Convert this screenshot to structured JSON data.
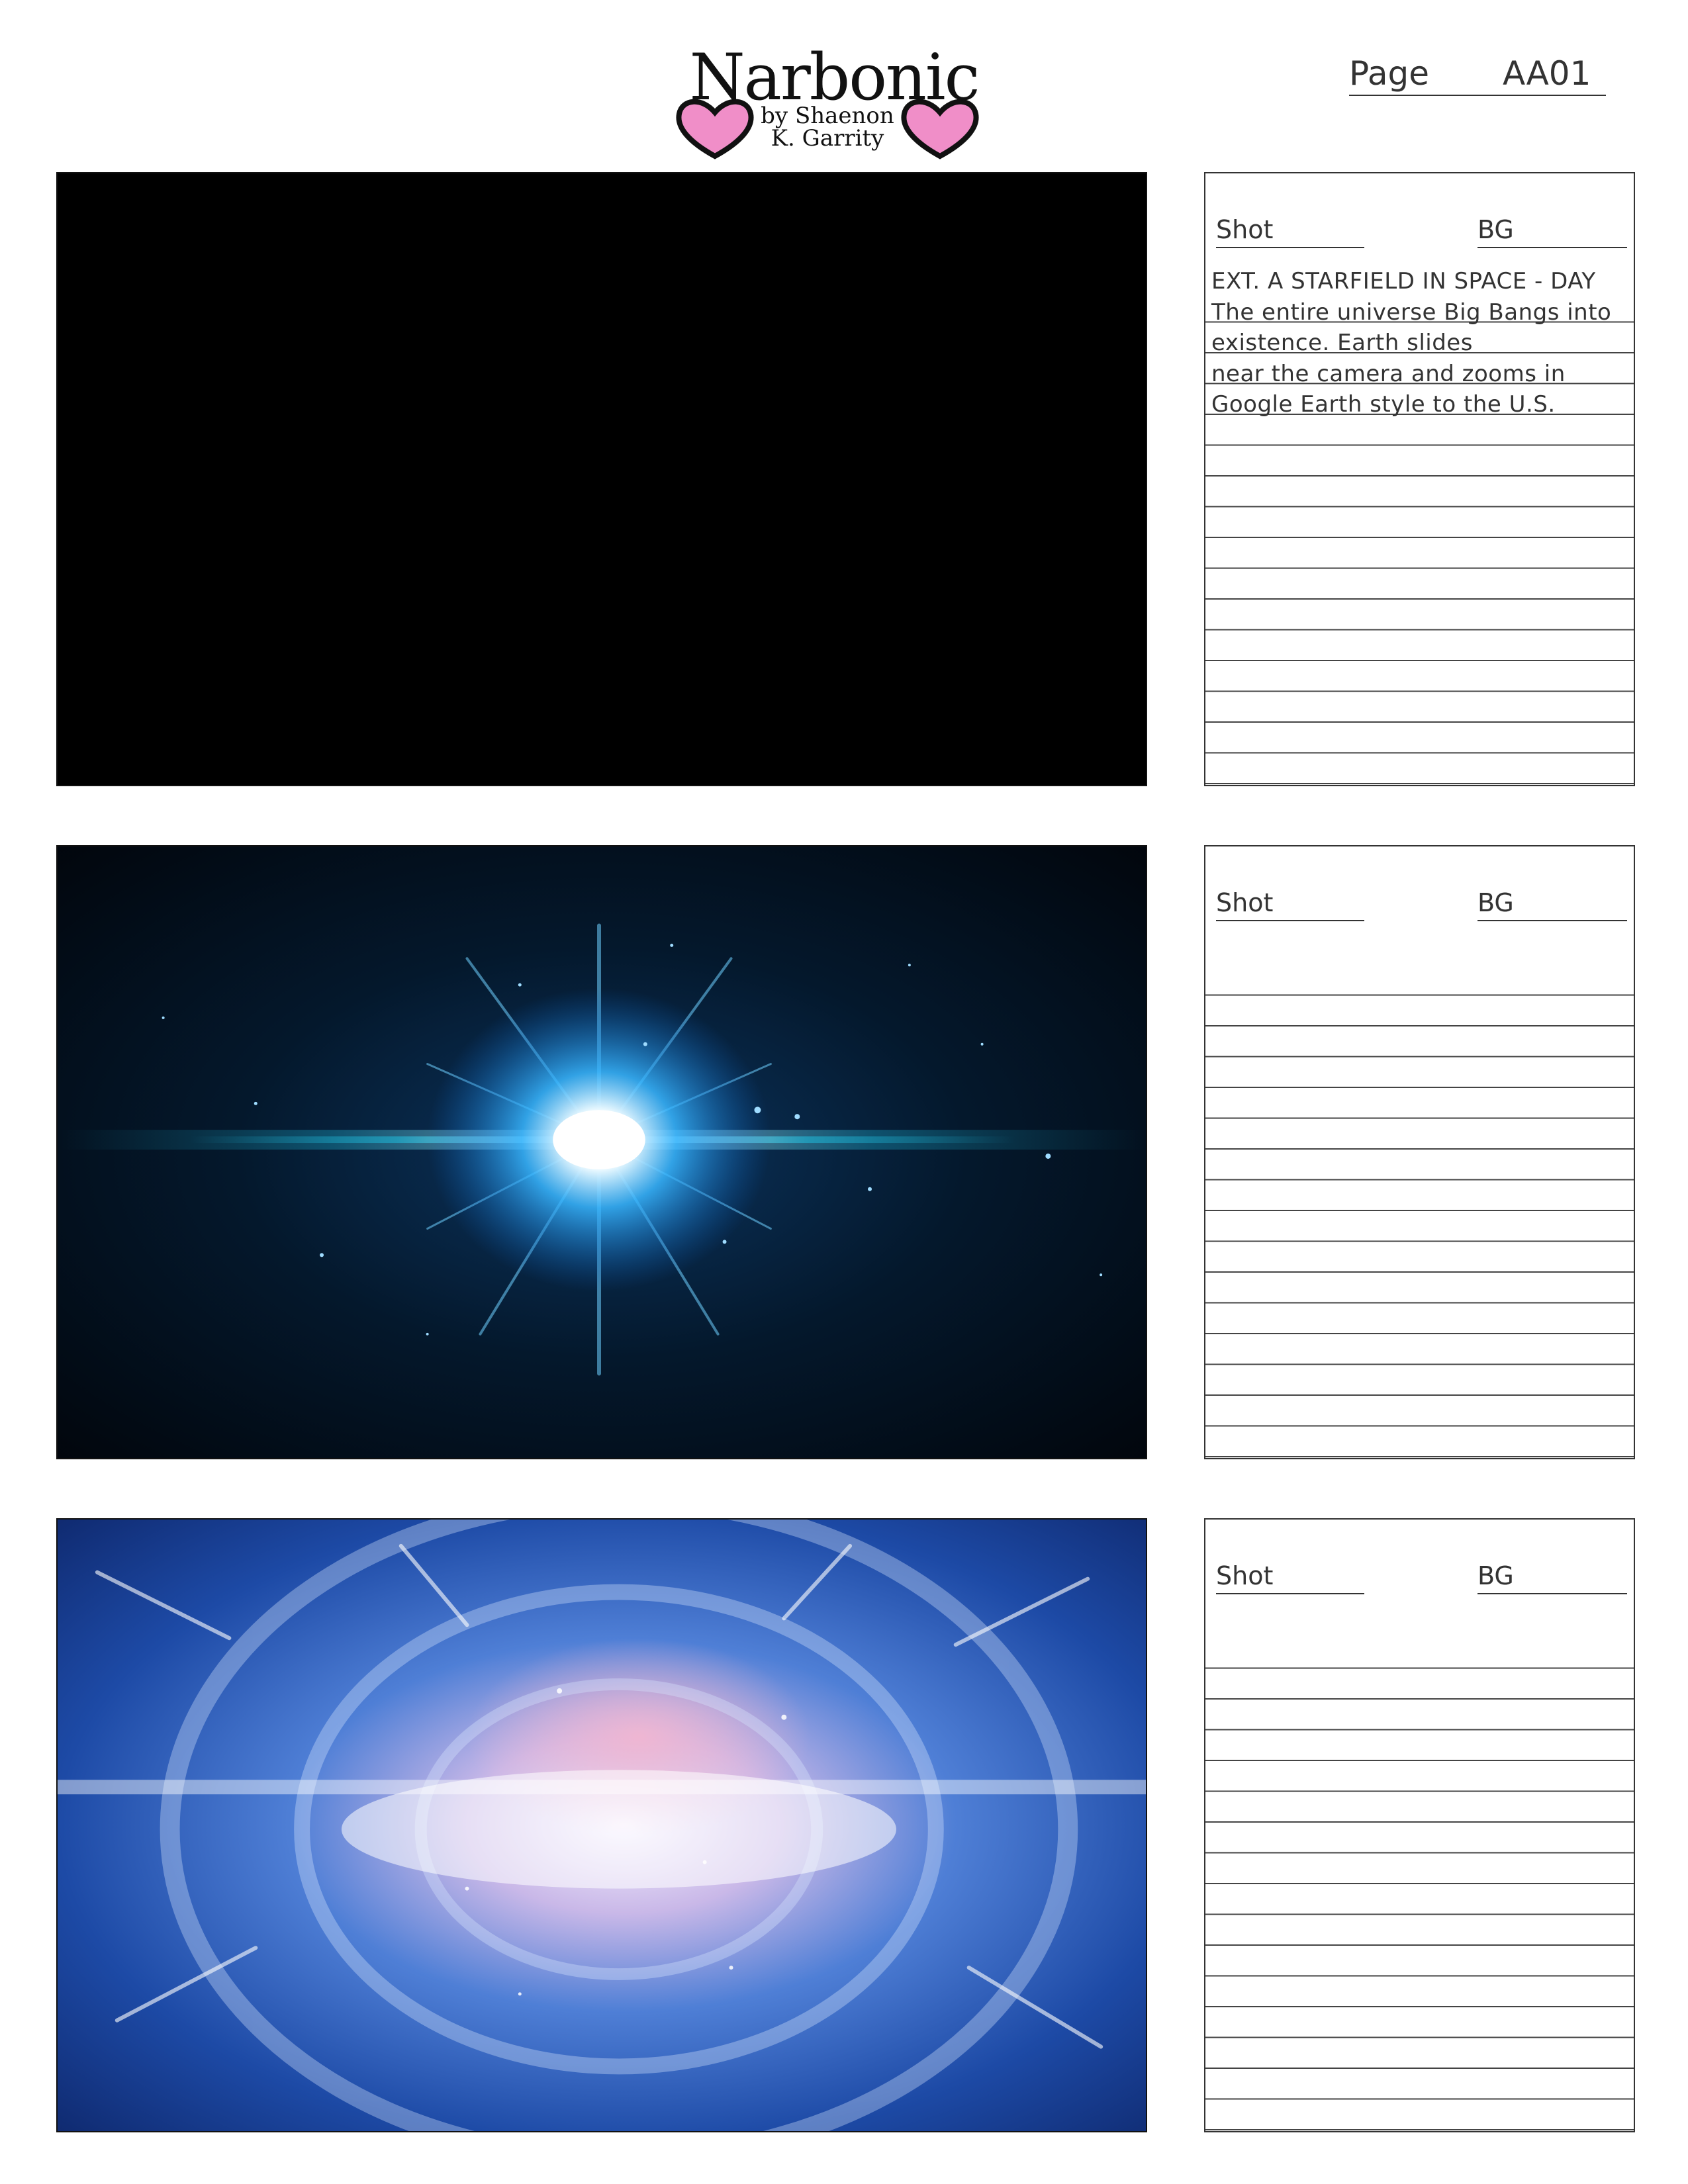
{
  "header": {
    "logo": {
      "title": "Narbonic",
      "byline_1": "by Shaenon",
      "byline_2": "K. Garrity",
      "icon": "heart-icon",
      "heart_color": "#f08ec8"
    },
    "page_label": "Page",
    "page_number": "AA01"
  },
  "panels": [
    {
      "image": "black-frame",
      "shot_label": "Shot",
      "bg_label": "BG",
      "scene_heading": "EXT. A STARFIELD IN SPACE - DAY",
      "description_lines": [
        "The entire universe Big Bangs into",
        "existence. Earth slides",
        "near the camera and zooms in",
        "Google Earth style to the U.S."
      ]
    },
    {
      "image": "big-bang-starburst",
      "shot_label": "Shot",
      "bg_label": "BG"
    },
    {
      "image": "warp-tunnel",
      "shot_label": "Shot",
      "bg_label": "BG"
    }
  ]
}
